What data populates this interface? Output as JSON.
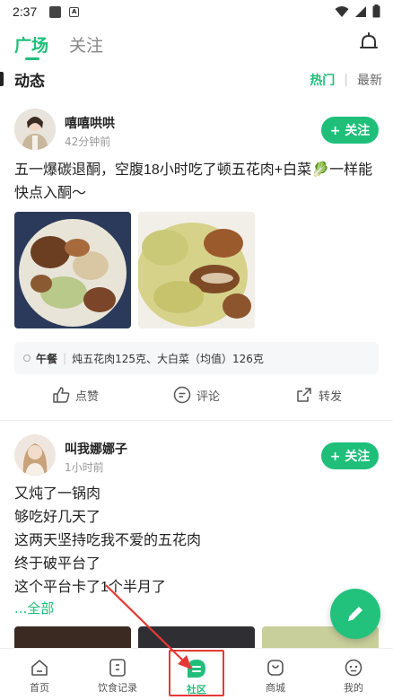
{
  "status_bar": {
    "time": "2:37"
  },
  "top_nav": {
    "tabs": [
      {
        "label": "广场",
        "active": true
      },
      {
        "label": "关注",
        "active": false
      }
    ]
  },
  "section": {
    "title": "动态",
    "sort_hot": "热门",
    "sort_separator": "|",
    "sort_new": "最新"
  },
  "posts": [
    {
      "username": "嘻嘻哄哄",
      "time": "42分钟前",
      "follow_label": "+ 关注",
      "text": "五一爆碳退酮，空腹18小时吃了顿五花肉+白菜🥬一样能快点入酮～",
      "photos": [
        "braised-pork-cabbage",
        "pork-belly-cabbage"
      ],
      "tag_meal": "午餐",
      "tag_separator": "|",
      "tag_foods": "炖五花肉125克、大白菜（均值）126克",
      "actions": {
        "like": "点赞",
        "comment": "评论",
        "share": "转发"
      }
    },
    {
      "username": "叫我娜娜子",
      "time": "1小时前",
      "follow_label": "+ 关注",
      "lines": [
        "又炖了一锅肉",
        "够吃好几天了",
        "这两天坚持吃我不爱的五花肉",
        "终于破平台了",
        "这个平台卡了1个半月了"
      ],
      "more_label": "...全部"
    }
  ],
  "bottom_nav": [
    {
      "label": "首页",
      "icon": "home-icon"
    },
    {
      "label": "饮食记录",
      "icon": "diet-record-icon"
    },
    {
      "label": "社区",
      "icon": "community-icon",
      "active": true
    },
    {
      "label": "商城",
      "icon": "mall-icon"
    },
    {
      "label": "我的",
      "icon": "profile-icon"
    }
  ],
  "colors": {
    "accent": "#1fbf7a",
    "highlight": "#e53935"
  }
}
